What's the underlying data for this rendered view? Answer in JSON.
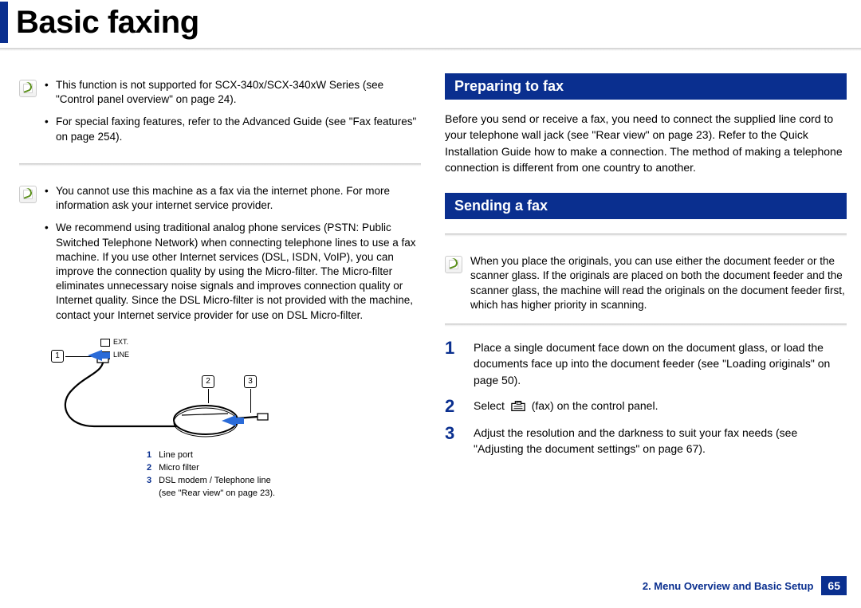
{
  "title": "Basic faxing",
  "left": {
    "note1": {
      "items": [
        "This function is not supported for SCX-340x/SCX-340xW Series (see \"Control panel overview\" on page 24).",
        "For special faxing features, refer to the Advanced Guide (see \"Fax features\" on page 254)."
      ]
    },
    "note2": {
      "items": [
        "You cannot use this machine as a fax via the internet phone. For more information ask your internet service provider.",
        "We recommend using traditional analog phone services (PSTN: Public Switched Telephone Network) when connecting telephone lines to use a fax machine. If you use other Internet services (DSL, ISDN, VoIP), you can improve the connection quality by using the Micro-filter. The Micro-filter eliminates unnecessary noise signals and improves connection quality or Internet quality. Since the DSL Micro-filter is not provided with the machine, contact your Internet service provider for use on DSL Micro-filter."
      ]
    },
    "diagram": {
      "ext_label": "EXT.",
      "line_label": "LINE",
      "callouts": [
        "1",
        "2",
        "3"
      ],
      "legend": [
        {
          "n": "1",
          "text": "Line port"
        },
        {
          "n": "2",
          "text": "Micro filter"
        },
        {
          "n": "3",
          "text": "DSL modem / Telephone line"
        },
        {
          "n": "",
          "text": "(see \"Rear view\" on page 23)."
        }
      ]
    }
  },
  "right": {
    "section1_title": "Preparing to fax",
    "section1_body": "Before you send or receive a fax, you need to connect the supplied line cord to your telephone wall jack (see \"Rear view\" on page 23). Refer to the Quick Installation Guide how to make a connection. The method of making a telephone connection is different from one country to another.",
    "section2_title": "Sending a fax",
    "note3": "When you place the originals, you can use either the document feeder or the scanner glass. If the originals are placed on both the document feeder and the scanner glass, the machine will read the originals on the document feeder first, which has higher priority in scanning.",
    "steps": [
      {
        "n": "1",
        "text": "Place a single document face down on the document glass, or load the documents face up into the document feeder (see \"Loading originals\" on page 50)."
      },
      {
        "n": "2",
        "text_before": "Select ",
        "text_after": " (fax) on the control panel."
      },
      {
        "n": "3",
        "text": "Adjust the resolution and the darkness to suit your fax needs (see \"Adjusting the document settings\" on page 67)."
      }
    ]
  },
  "footer": {
    "chapter": "2.  Menu Overview and Basic Setup",
    "page": "65"
  }
}
